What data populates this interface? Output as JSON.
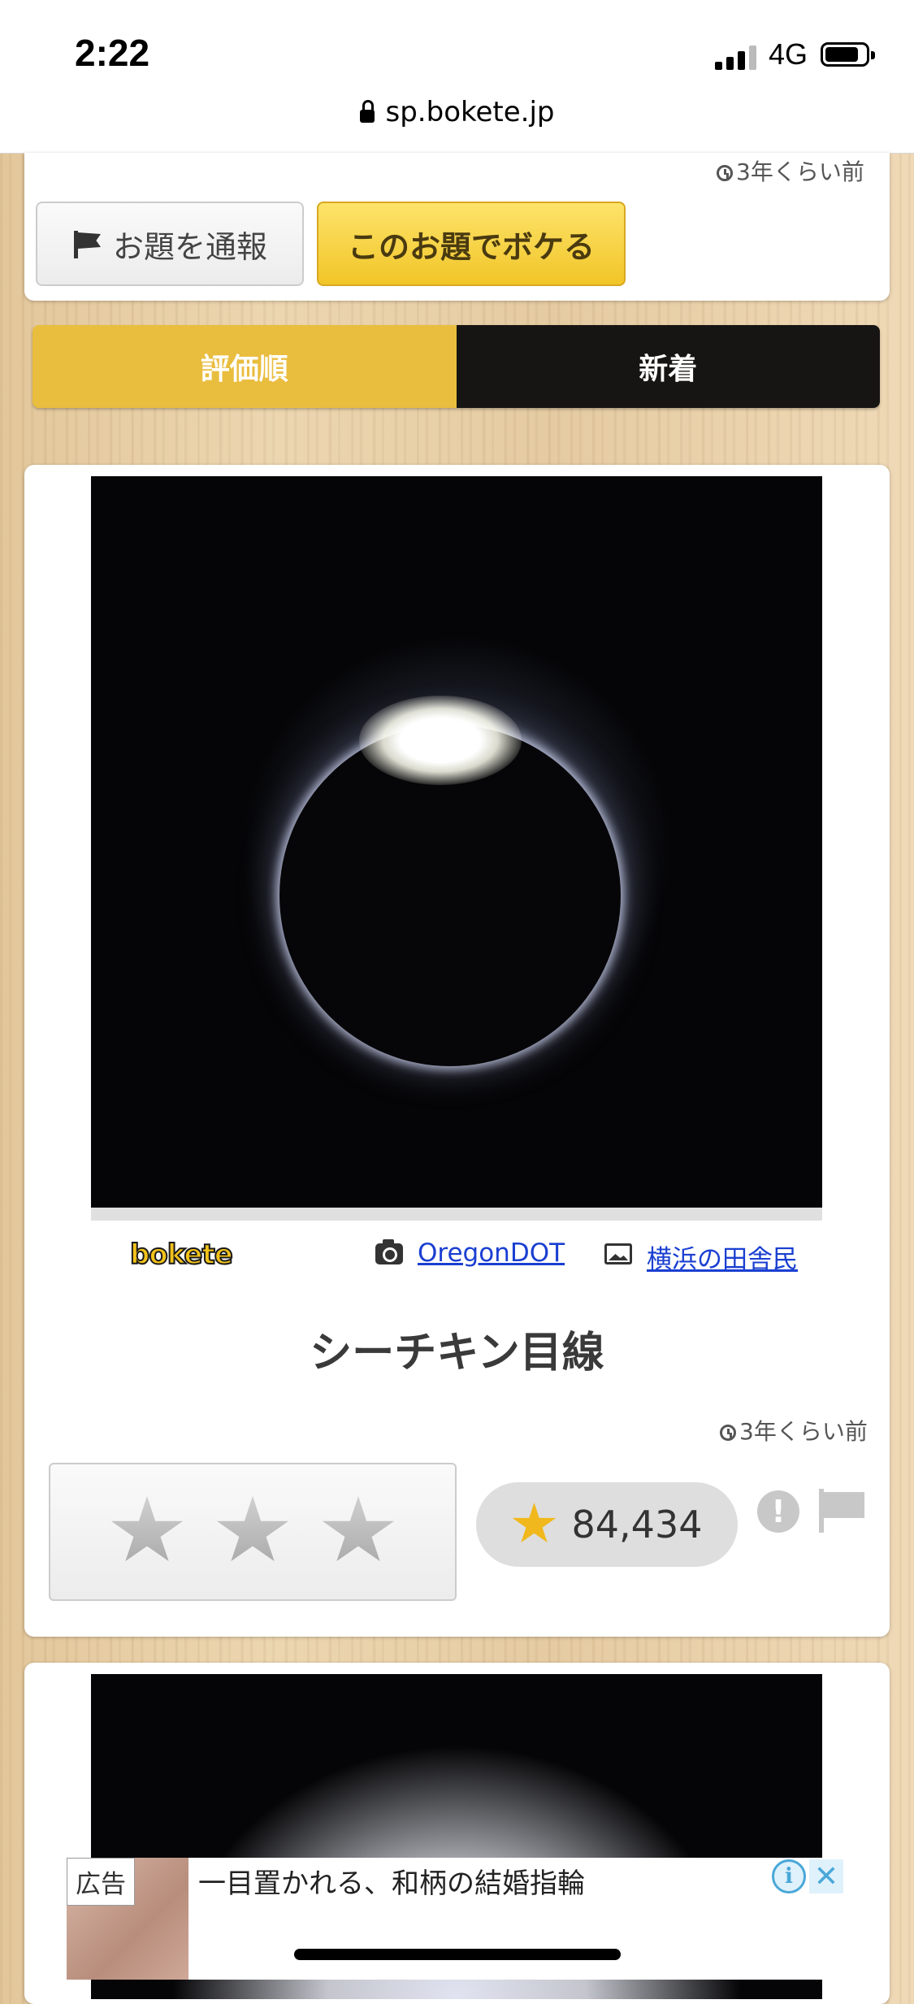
{
  "status_bar": {
    "time": "2:22",
    "network": "4G"
  },
  "browser": {
    "url": "sp.bokete.jp"
  },
  "top_card": {
    "time_ago": "3年くらい前",
    "report_label": "お題を通報",
    "boke_label": "このお題でボケる"
  },
  "tabs": [
    {
      "label": "評価順"
    },
    {
      "label": "新着"
    }
  ],
  "post": {
    "logo_text": "bokete",
    "photographer": "OregonDOT",
    "uploader": "横浜の田舎民",
    "caption": "シーチキン目線",
    "time_ago": "3年くらい前",
    "star_count": "84,434",
    "rating": {
      "max": 3,
      "selected": 0
    }
  },
  "ad": {
    "label": "広告",
    "text": "一目置かれる、和柄の結婚指輪",
    "info_glyph": "i",
    "close_glyph": "✕"
  },
  "colors": {
    "accent_yellow": "#e9bd3e",
    "tab_dark": "#171513",
    "link_blue": "#1a3fd1",
    "gold_star": "#f0b81c"
  }
}
